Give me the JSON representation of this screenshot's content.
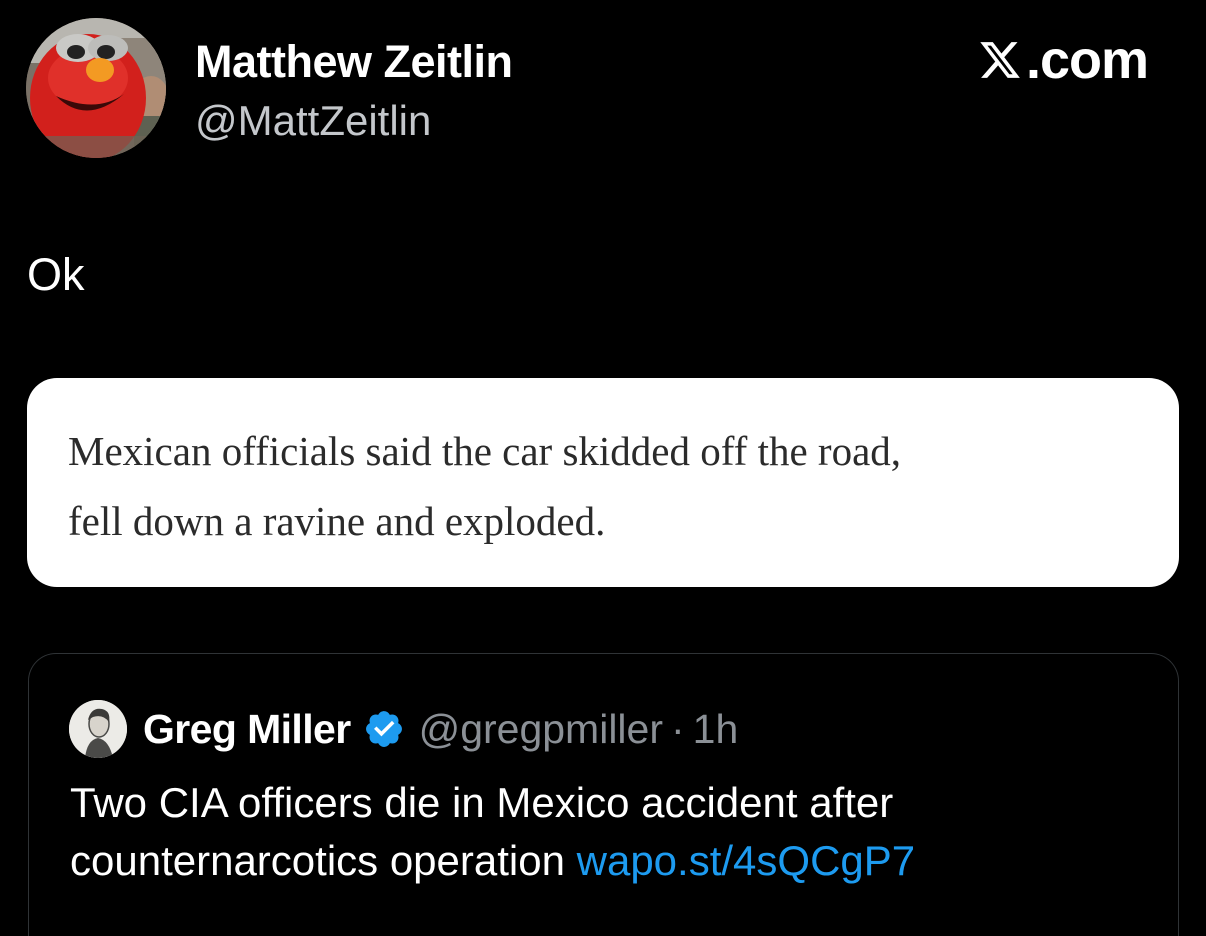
{
  "author": {
    "name": "Matthew Zeitlin",
    "handle": "@MattZeitlin",
    "avatar_icon": "elmo-avatar-photo"
  },
  "brand": {
    "label": ".com",
    "icon": "x-logo-icon"
  },
  "tweet": {
    "text": "Ok"
  },
  "quote_card": {
    "line1": "Mexican officials said the car skidded off the road,",
    "line2": "fell down a ravine and exploded."
  },
  "embedded_tweet": {
    "name": "Greg Miller",
    "verified_icon": "verified-badge-icon",
    "handle": "@gregpmiller",
    "separator": "·",
    "time": "1h",
    "text_line1": "Two CIA officers die in Mexico accident after",
    "text_line2_prefix": "counternarcotics operation ",
    "link": "wapo.st/4sQCgP7"
  },
  "colors": {
    "background": "#000000",
    "link": "#1d9bf0",
    "verified": "#1d9bf0",
    "muted": "#8b9096"
  }
}
